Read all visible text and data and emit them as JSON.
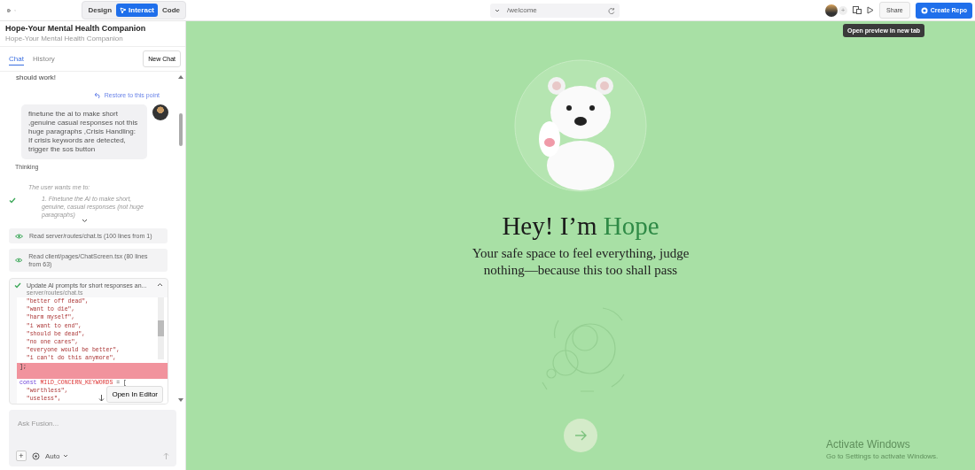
{
  "toolbar": {
    "modes": [
      {
        "label": "Design",
        "selected": false
      },
      {
        "label": "Interact",
        "selected": true
      },
      {
        "label": "Code",
        "selected": false
      }
    ],
    "url": "/welcome",
    "add_collaborator": "+",
    "share": "Share",
    "create_repo": "Create Repo",
    "tooltip": "Open preview in new tab"
  },
  "project": {
    "title": "Hope-Your Mental Health Companion",
    "subtitle": "Hope-Your Mental Health Companion"
  },
  "tabs": [
    {
      "label": "Chat",
      "selected": true
    },
    {
      "label": "History",
      "selected": false
    }
  ],
  "new_chat": "New Chat",
  "chat": {
    "tail": "should work!",
    "restore": "Restore to this point",
    "user_message": "finetune the ai to make short ,genuine casual responses not this huge paragraphs ,Crisis Handling: If crisis keywords are detected, trigger the sos button",
    "thinking": {
      "label": "Thinking",
      "intro": "The user wants me to:",
      "step": "1. Finetune the AI to make short, genuine, casual responses (not huge paragraphs)",
      "done": true
    },
    "reads": [
      {
        "text": "Read server/routes/chat.ts (100 lines from 1)"
      },
      {
        "text": "Read client/pages/ChatScreen.tsx (80 lines from 63)"
      }
    ],
    "edit": {
      "title": "Update AI prompts for short responses an...",
      "file": "server/routes/chat.ts",
      "done": true,
      "expanded": true,
      "lines": [
        {
          "tokens": [
            {
              "text": "  \"better off dead\",",
              "kind": "string"
            }
          ],
          "highlighted": false
        },
        {
          "tokens": [
            {
              "text": "  \"want to die\",",
              "kind": "string"
            }
          ],
          "highlighted": false
        },
        {
          "tokens": [
            {
              "text": "  \"harm myself\",",
              "kind": "string"
            }
          ],
          "highlighted": false
        },
        {
          "tokens": [
            {
              "text": "  \"i want to end\",",
              "kind": "string"
            }
          ],
          "highlighted": false
        },
        {
          "tokens": [
            {
              "text": "  \"should be dead\",",
              "kind": "string"
            }
          ],
          "highlighted": false
        },
        {
          "tokens": [
            {
              "text": "  \"no one cares\",",
              "kind": "string"
            }
          ],
          "highlighted": false
        },
        {
          "tokens": [
            {
              "text": "  \"everyone would be better\",",
              "kind": "string"
            }
          ],
          "highlighted": false
        },
        {
          "tokens": [
            {
              "text": "  \"i can't do this anymore\",",
              "kind": "string"
            }
          ],
          "highlighted": false
        },
        {
          "tokens": [
            {
              "text": "];",
              "kind": "punct"
            }
          ],
          "highlighted": true
        },
        {
          "highlighted": true
        },
        {
          "tokens": [
            {
              "text": "const",
              "kind": "keyword"
            },
            {
              "text": " MILD_CONCERN_KEYWORDS",
              "kind": "name"
            },
            {
              "text": " = [",
              "kind": "punct"
            }
          ],
          "highlighted": false
        },
        {
          "tokens": [
            {
              "text": "  \"worthless\",",
              "kind": "string"
            }
          ],
          "highlighted": false
        },
        {
          "tokens": [
            {
              "text": "  \"useless\",",
              "kind": "string"
            }
          ],
          "highlighted": false
        }
      ],
      "open_editor": "Open In Editor"
    }
  },
  "composer": {
    "placeholder": "Ask Fusion...",
    "add": "+",
    "mode": "Auto"
  },
  "preview": {
    "heading": "Hey! I’m ",
    "heading_name": "Hope",
    "tagline": "Your safe space to feel everything, judge nothing—because this too shall pass"
  },
  "watermark": {
    "title": "Activate Windows",
    "text": "Go to Settings to activate Windows."
  }
}
